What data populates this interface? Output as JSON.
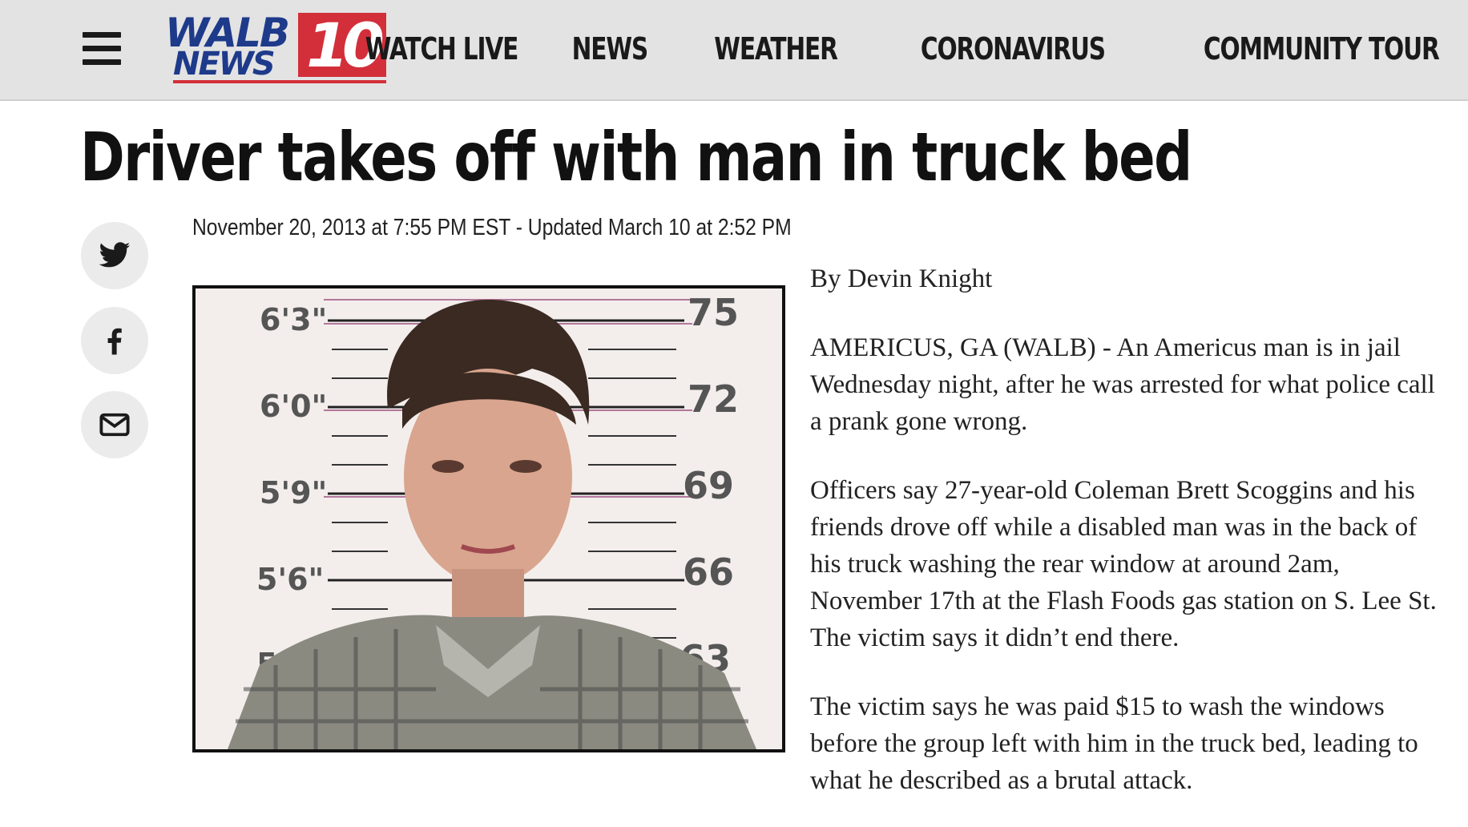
{
  "header": {
    "menu_icon": "hamburger-menu-icon",
    "logo": {
      "line1": "WALB",
      "line2": "NEWS",
      "channel": "10",
      "brand_blue": "#1e3a8a",
      "brand_red": "#d32f3a"
    },
    "nav": [
      {
        "label": "WATCH LIVE"
      },
      {
        "label": "NEWS"
      },
      {
        "label": "WEATHER"
      },
      {
        "label": "CORONAVIRUS"
      },
      {
        "label": "COMMUNITY TOUR"
      }
    ]
  },
  "article": {
    "headline": "Driver takes off with man in truck bed",
    "dateline": "November 20, 2013 at 7:55 PM EST - Updated March 10 at 2:52 PM",
    "share": [
      {
        "icon": "twitter-icon"
      },
      {
        "icon": "facebook-icon"
      },
      {
        "icon": "email-icon"
      }
    ],
    "photo": {
      "height_labels_left": [
        "6'3\"",
        "6'0\"",
        "5'9\"",
        "5'6\"",
        "5'3\""
      ],
      "height_labels_right": [
        "75",
        "72",
        "69",
        "66",
        "63"
      ]
    },
    "byline": "By Devin Knight",
    "paragraphs": [
      "AMERICUS, GA (WALB) - An Americus man is in jail Wednesday night, after he was arrested for what police call a prank gone wrong.",
      "Officers say 27-year-old Coleman Brett Scoggins and his friends drove off while a disabled man was in the back of his truck washing the rear window at around 2am, November 17th at the Flash Foods gas station on S. Lee St. The victim says it didn’t end there.",
      "The victim says he was paid $15 to wash the windows before the group left with him in the truck bed, leading to what he described as a brutal attack."
    ]
  }
}
